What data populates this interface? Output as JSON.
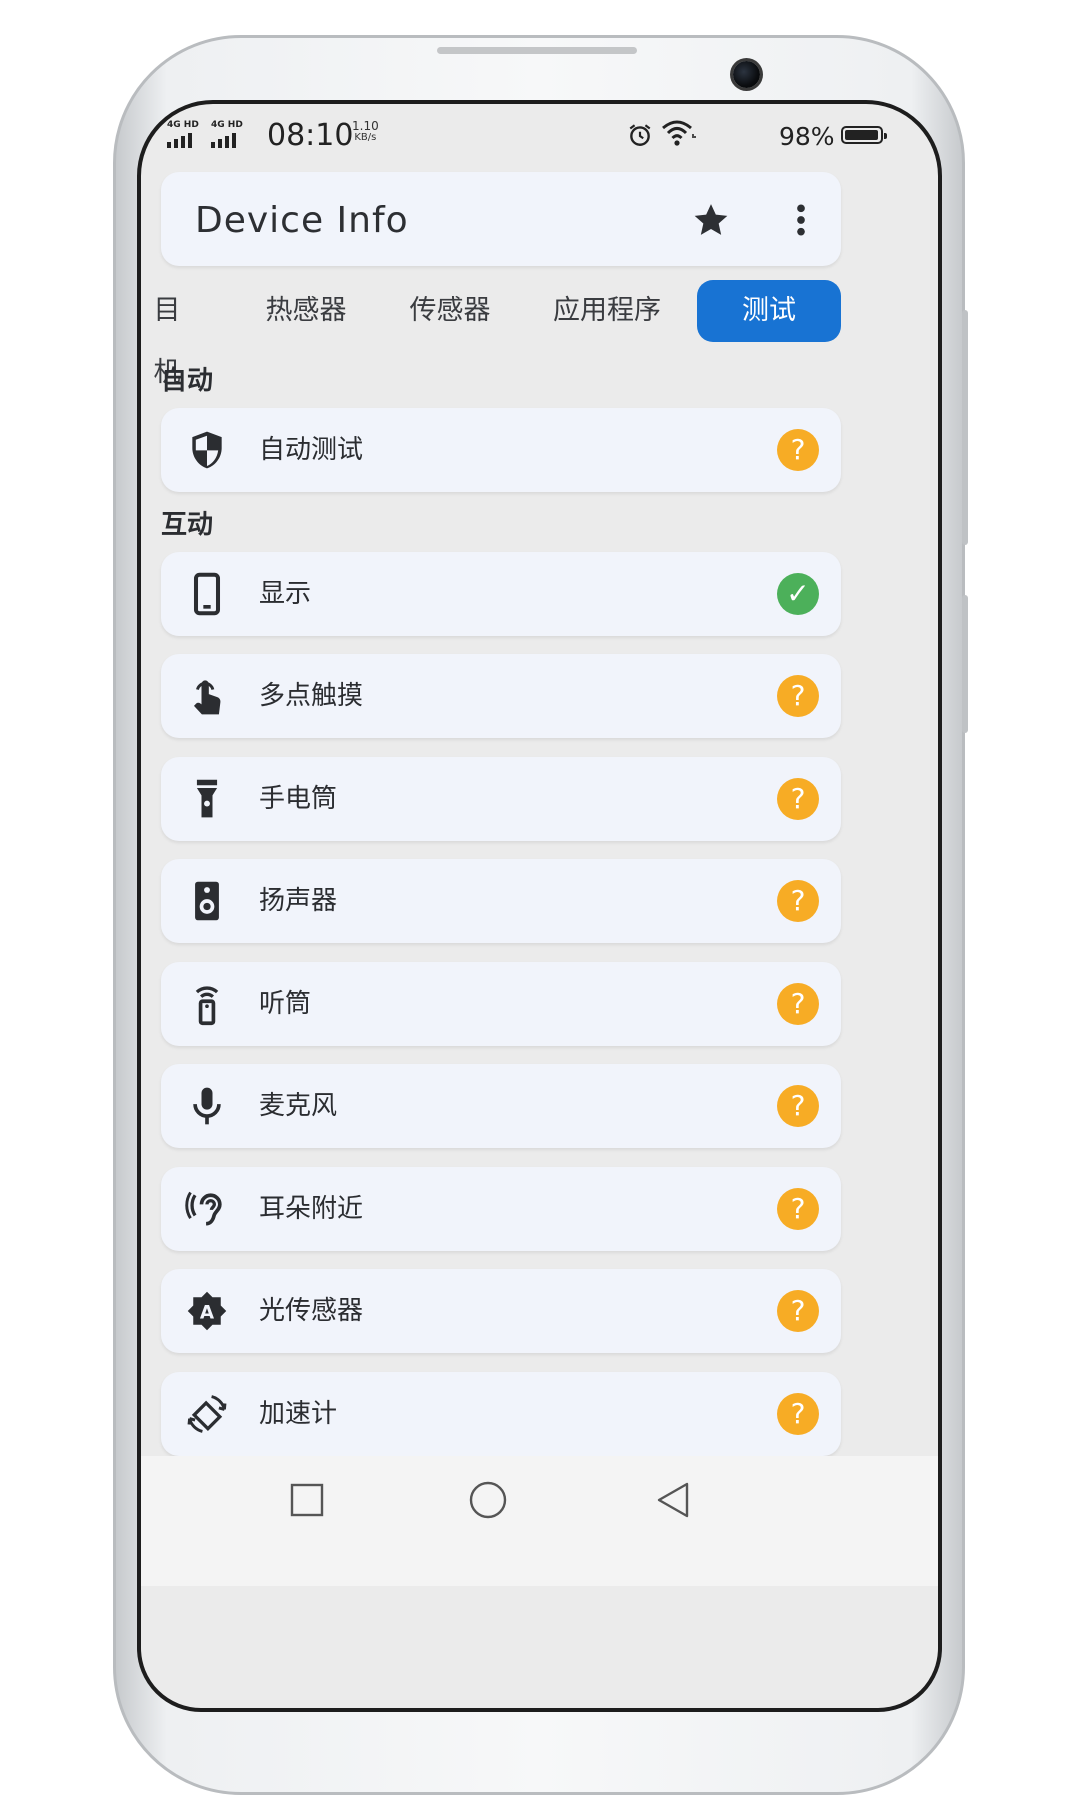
{
  "status_bar": {
    "sim1": "4G HD",
    "sim2": "4G HD",
    "time": "08:10",
    "speed_value": "1.10",
    "speed_unit": "KB/s",
    "battery": "98%"
  },
  "app_bar": {
    "title": "Device Info",
    "star_icon": "star-icon",
    "more_icon": "more-vertical-icon"
  },
  "tabs": [
    {
      "label": "目机",
      "active": false
    },
    {
      "label": "热感器",
      "active": false
    },
    {
      "label": "传感器",
      "active": false
    },
    {
      "label": "应用程序",
      "active": false
    },
    {
      "label": "测试",
      "active": true
    }
  ],
  "sections": {
    "auto": {
      "title": "自动",
      "items": [
        {
          "label": "自动测试",
          "icon": "shield-icon",
          "status": "unknown"
        }
      ]
    },
    "interactive": {
      "title": "互动",
      "items": [
        {
          "label": "显示",
          "icon": "phone-icon",
          "status": "passed"
        },
        {
          "label": "多点触摸",
          "icon": "touch-icon",
          "status": "unknown"
        },
        {
          "label": "手电筒",
          "icon": "flashlight-icon",
          "status": "unknown"
        },
        {
          "label": "扬声器",
          "icon": "speaker-icon",
          "status": "unknown"
        },
        {
          "label": "听筒",
          "icon": "earpiece-icon",
          "status": "unknown"
        },
        {
          "label": "麦克风",
          "icon": "microphone-icon",
          "status": "unknown"
        },
        {
          "label": "耳朵附近",
          "icon": "ear-icon",
          "status": "unknown"
        },
        {
          "label": "光传感器",
          "icon": "brightness-auto-icon",
          "status": "unknown"
        },
        {
          "label": "加速计",
          "icon": "screen-rotation-icon",
          "status": "unknown"
        }
      ]
    }
  },
  "status_glyphs": {
    "unknown": "?",
    "passed": "✓"
  },
  "colors": {
    "accent": "#1873d3",
    "unknown": "#f7ac25",
    "passed": "#4cb05a",
    "card": "#f1f4fb",
    "background": "#ebebeb"
  },
  "nav_bar": {
    "recent_icon": "square-recent-icon",
    "home_icon": "circle-home-icon",
    "back_icon": "triangle-back-icon"
  }
}
